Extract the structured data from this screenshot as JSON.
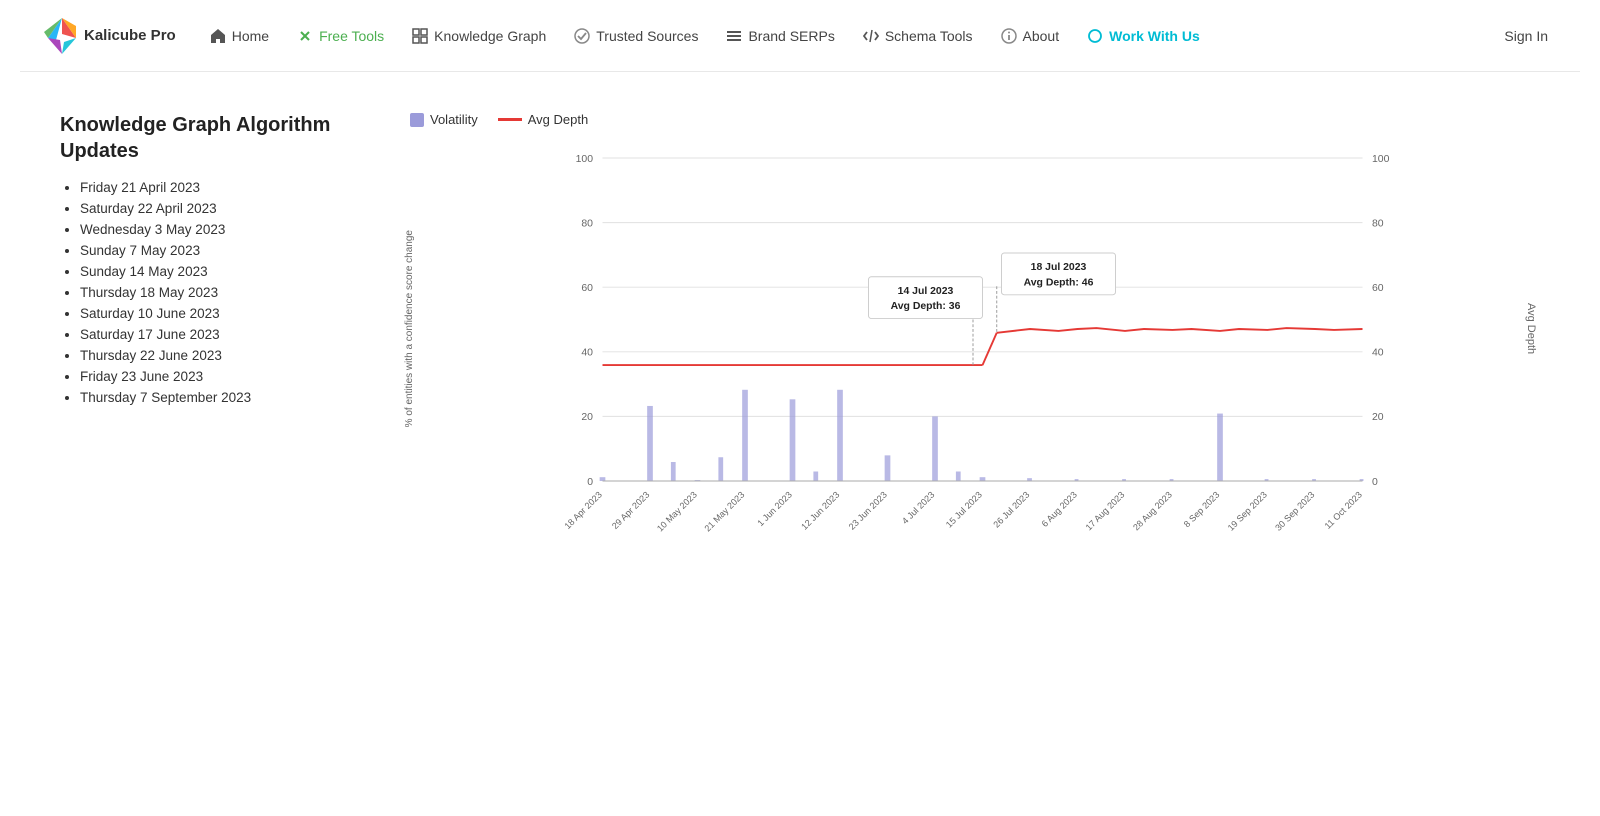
{
  "brand": {
    "name": "Kalicube Pro"
  },
  "nav": {
    "items": [
      {
        "label": "Home",
        "icon": "home-icon",
        "active": false
      },
      {
        "label": "Free Tools",
        "icon": "scissors-icon",
        "active": true,
        "highlight_green": true
      },
      {
        "label": "Knowledge Graph",
        "icon": "grid-icon",
        "active": false
      },
      {
        "label": "Trusted Sources",
        "icon": "check-icon",
        "active": false
      },
      {
        "label": "Brand SERPs",
        "icon": "menu-icon",
        "active": false
      },
      {
        "label": "Schema Tools",
        "icon": "code-icon",
        "active": false
      },
      {
        "label": "About",
        "icon": "info-icon",
        "active": false
      },
      {
        "label": "Work With Us",
        "icon": "circle-icon",
        "active": false,
        "highlight_cyan": true
      }
    ],
    "signin": "Sign In"
  },
  "page": {
    "title": "Knowledge Graph Algorithm Updates",
    "dates": [
      "Friday 21 April 2023",
      "Saturday 22 April 2023",
      "Wednesday 3 May 2023",
      "Sunday 7 May 2023",
      "Sunday 14 May 2023",
      "Thursday 18 May 2023",
      "Saturday 10 June 2023",
      "Saturday 17 June 2023",
      "Thursday 22 June 2023",
      "Friday 23 June 2023",
      "Thursday 7 September 2023"
    ]
  },
  "chart": {
    "legend": {
      "volatility_label": "Volatility",
      "avg_depth_label": "Avg Depth"
    },
    "y_axis_left_label": "% of entities with a confidence score change",
    "y_axis_right_label": "Avg Depth",
    "y_ticks": [
      0,
      20,
      40,
      60,
      80,
      100
    ],
    "x_labels": [
      "18 Apr 2023",
      "29 Apr 2023",
      "10 May 2023",
      "21 May 2023",
      "1 Jun 2023",
      "12 Jun 2023",
      "23 Jun 2023",
      "4 Jul 2023",
      "15 Jul 2023",
      "26 Jul 2023",
      "6 Aug 2023",
      "17 Aug 2023",
      "28 Aug 2023",
      "8 Sep 2023",
      "19 Sep 2023",
      "30 Sep 2023",
      "11 Oct 2023"
    ],
    "tooltip1": {
      "date": "14 Jul 2023",
      "label": "Avg Depth: 36"
    },
    "tooltip2": {
      "date": "18 Jul 2023",
      "label": "Avg Depth: 46"
    }
  }
}
